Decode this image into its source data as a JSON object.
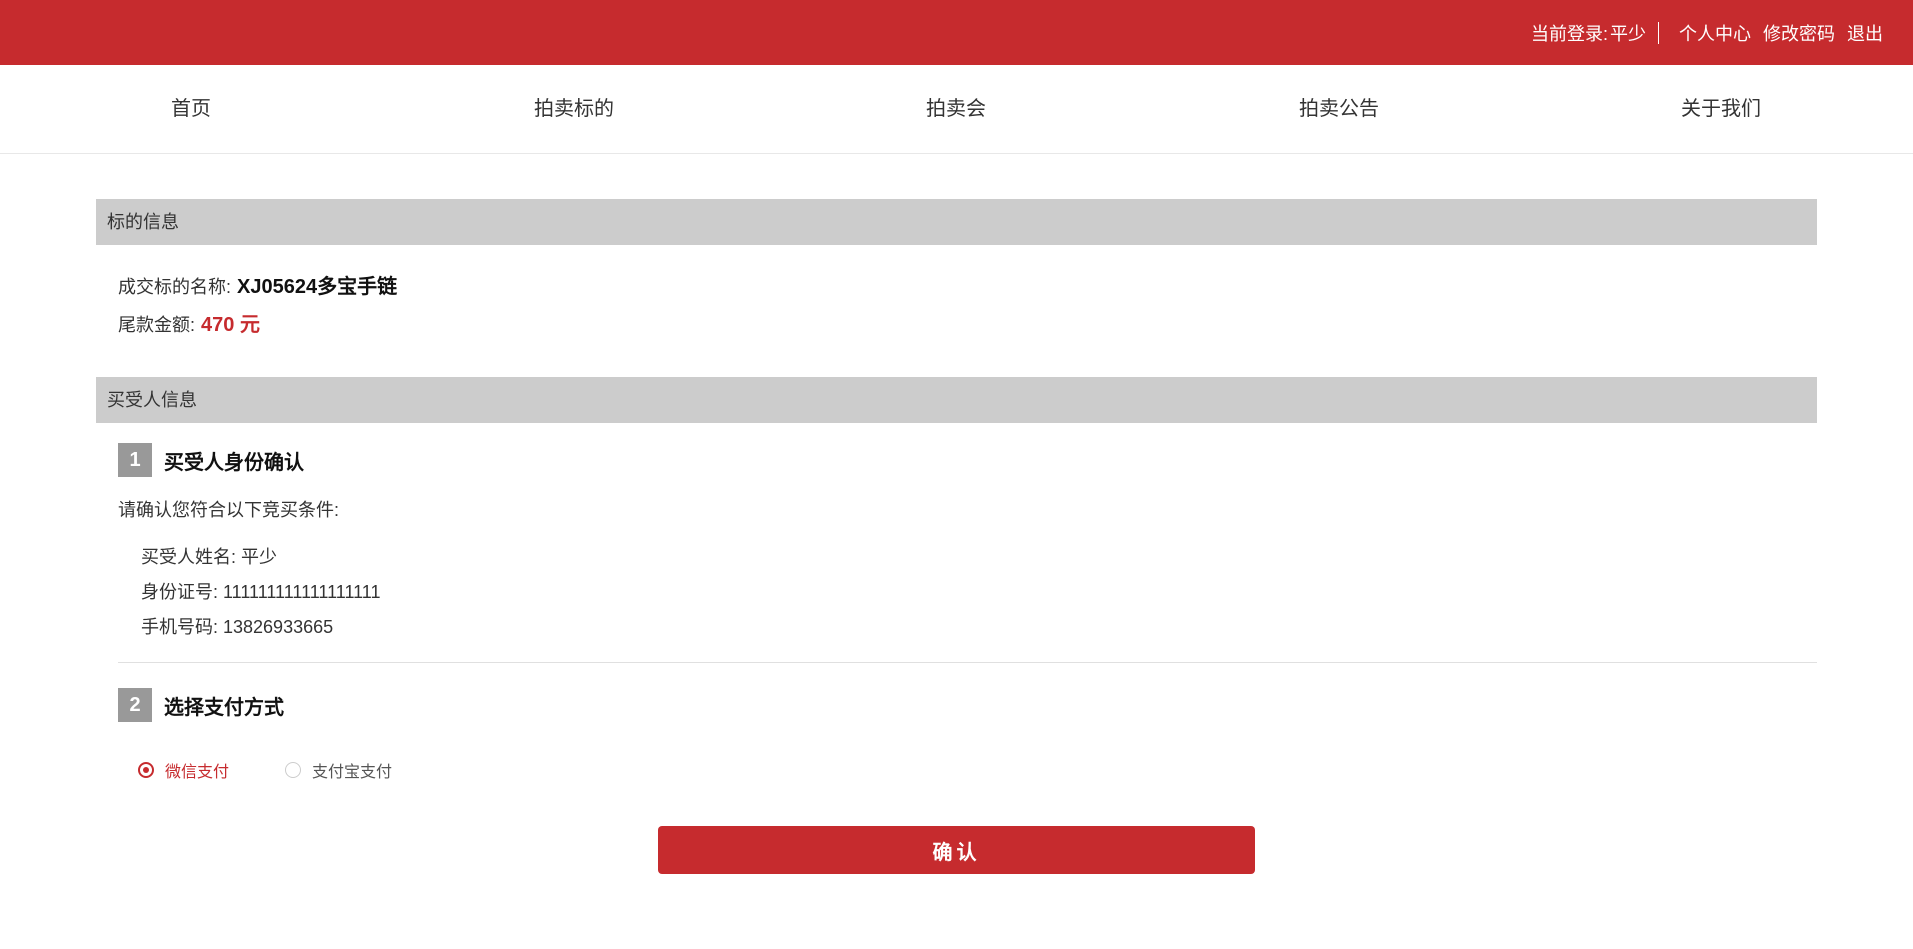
{
  "topbar": {
    "login_label": "当前登录:",
    "username": "平少",
    "links": [
      "个人中心",
      "修改密码",
      "退出"
    ]
  },
  "nav": {
    "items": [
      "首页",
      "拍卖标的",
      "拍卖会",
      "拍卖公告",
      "关于我们"
    ]
  },
  "lot_info": {
    "header": "标的信息",
    "name_label": "成交标的名称:",
    "name_value": "XJ05624多宝手链",
    "balance_label": "尾款金额:",
    "balance_value": "470 元"
  },
  "buyer_info": {
    "header": "买受人信息",
    "step1": {
      "number": "1",
      "title": "买受人身份确认",
      "prompt": "请确认您符合以下竞买条件:",
      "name_line": "买受人姓名: 平少",
      "id_line": "身份证号: 111111111111111111",
      "phone_line": "手机号码: 13826933665"
    },
    "step2": {
      "number": "2",
      "title": "选择支付方式",
      "options": [
        {
          "label": "微信支付",
          "selected": true
        },
        {
          "label": "支付宝支付",
          "selected": false
        }
      ]
    }
  },
  "confirm_button": "确认",
  "colors": {
    "brand_red": "#c62b2e",
    "section_gray": "#cccccc",
    "step_badge_gray": "#999999"
  }
}
